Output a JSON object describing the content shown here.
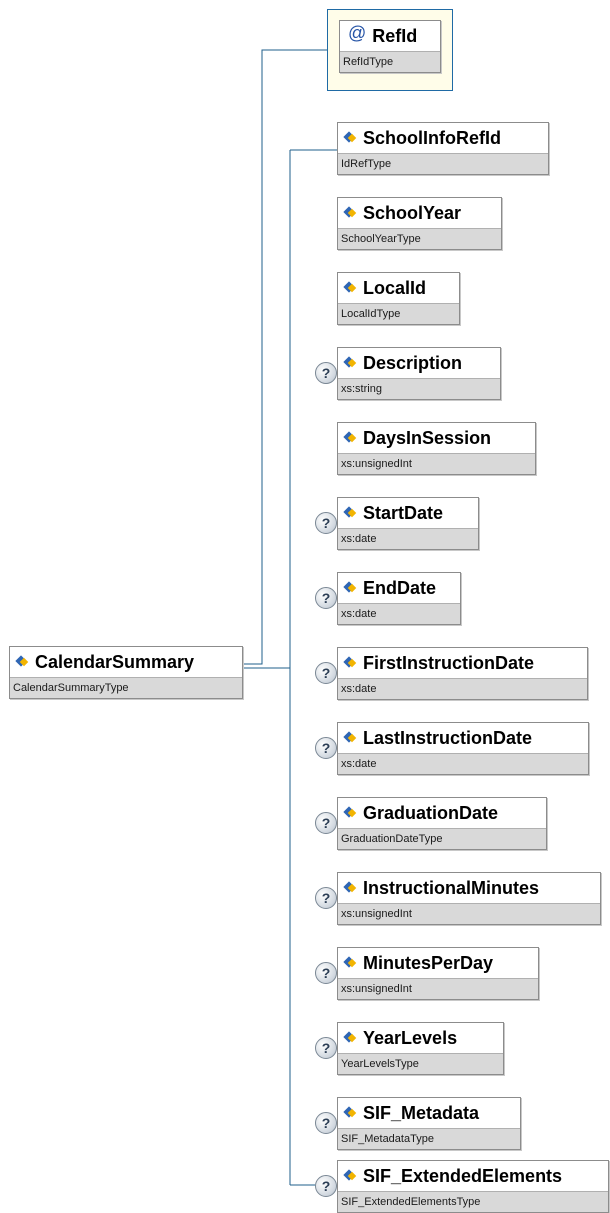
{
  "root": {
    "name": "CalendarSummary",
    "type": "CalendarSummaryType"
  },
  "attribute": {
    "name": "RefId",
    "type": "RefIdType"
  },
  "elements": [
    {
      "name": "SchoolInfoRefId",
      "type": "IdRefType",
      "optional": false
    },
    {
      "name": "SchoolYear",
      "type": "SchoolYearType",
      "optional": false
    },
    {
      "name": "LocalId",
      "type": "LocalIdType",
      "optional": false
    },
    {
      "name": "Description",
      "type": "xs:string",
      "optional": true
    },
    {
      "name": "DaysInSession",
      "type": "xs:unsignedInt",
      "optional": false
    },
    {
      "name": "StartDate",
      "type": "xs:date",
      "optional": true
    },
    {
      "name": "EndDate",
      "type": "xs:date",
      "optional": true
    },
    {
      "name": "FirstInstructionDate",
      "type": "xs:date",
      "optional": true
    },
    {
      "name": "LastInstructionDate",
      "type": "xs:date",
      "optional": true
    },
    {
      "name": "GraduationDate",
      "type": "GraduationDateType",
      "optional": true
    },
    {
      "name": "InstructionalMinutes",
      "type": "xs:unsignedInt",
      "optional": true
    },
    {
      "name": "MinutesPerDay",
      "type": "xs:unsignedInt",
      "optional": true
    },
    {
      "name": "YearLevels",
      "type": "YearLevelsType",
      "optional": true
    },
    {
      "name": "SIF_Metadata",
      "type": "SIF_MetadataType",
      "optional": true
    },
    {
      "name": "SIF_ExtendedElements",
      "type": "SIF_ExtendedElementsType",
      "optional": true
    }
  ],
  "icons": {
    "element": "element-diamond-icon",
    "attribute": "attribute-at-icon",
    "optional": "optional-question-icon"
  },
  "colors": {
    "connector": "#1f5f8b",
    "type_band": "#d9d9d9",
    "attribute_bg": "#fffde9",
    "icon_blue": "#2f66b4",
    "icon_gold": "#f2b400"
  }
}
